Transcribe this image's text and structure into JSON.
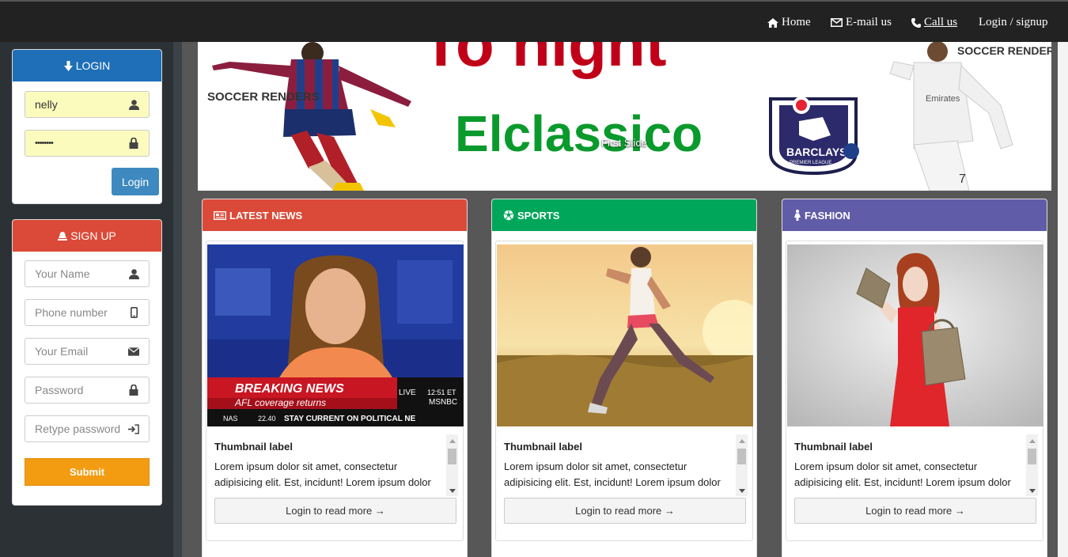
{
  "nav": {
    "home": "Home",
    "email": "E-mail us",
    "call": "Call us",
    "login": "Login / signup"
  },
  "login": {
    "title": "LOGIN",
    "username_value": "nelly",
    "password_value": "••••••••",
    "button": "Login"
  },
  "signup": {
    "title": "SIGN UP",
    "name_placeholder": "Your Name",
    "phone_placeholder": "Phone number",
    "email_placeholder": "Your Email",
    "password_placeholder": "Password",
    "retype_placeholder": "Retype password",
    "submit": "Submit"
  },
  "slider": {
    "headline_top": "To night",
    "headline": "Elclassico",
    "caption": "First Slide",
    "brand": "SOCCER RENDERS",
    "league_name": "BARCLAYS",
    "league_sub": "PREMIER LEAGUE"
  },
  "cards": [
    {
      "title": "LATEST NEWS",
      "color": "#db4a39",
      "label": "Thumbnail label",
      "text": "Lorem ipsum dolor sit amet, consectetur adipisicing elit. Est, incidunt! Lorem ipsum dolor",
      "button": "Login to read more →",
      "banner": "BREAKING NEWS",
      "banner_sub": "AFL coverage returns",
      "ticker": "STAY CURRENT ON POLITICAL NE",
      "live": "LIVE",
      "time": "12:51 ET",
      "channel": "MSNBC",
      "nas": "NAS",
      "nas_value": "22.40"
    },
    {
      "title": "SPORTS",
      "color": "#00a65a",
      "label": "Thumbnail label",
      "text": "Lorem ipsum dolor sit amet, consectetur adipisicing elit. Est, incidunt! Lorem ipsum dolor",
      "button": "Login to read more →"
    },
    {
      "title": "FASHION",
      "color": "#605ca8",
      "label": "Thumbnail label",
      "text": "Lorem ipsum dolor sit amet, consectetur adipisicing elit. Est, incidunt! Lorem ipsum dolor",
      "button": "Login to read more →"
    }
  ]
}
